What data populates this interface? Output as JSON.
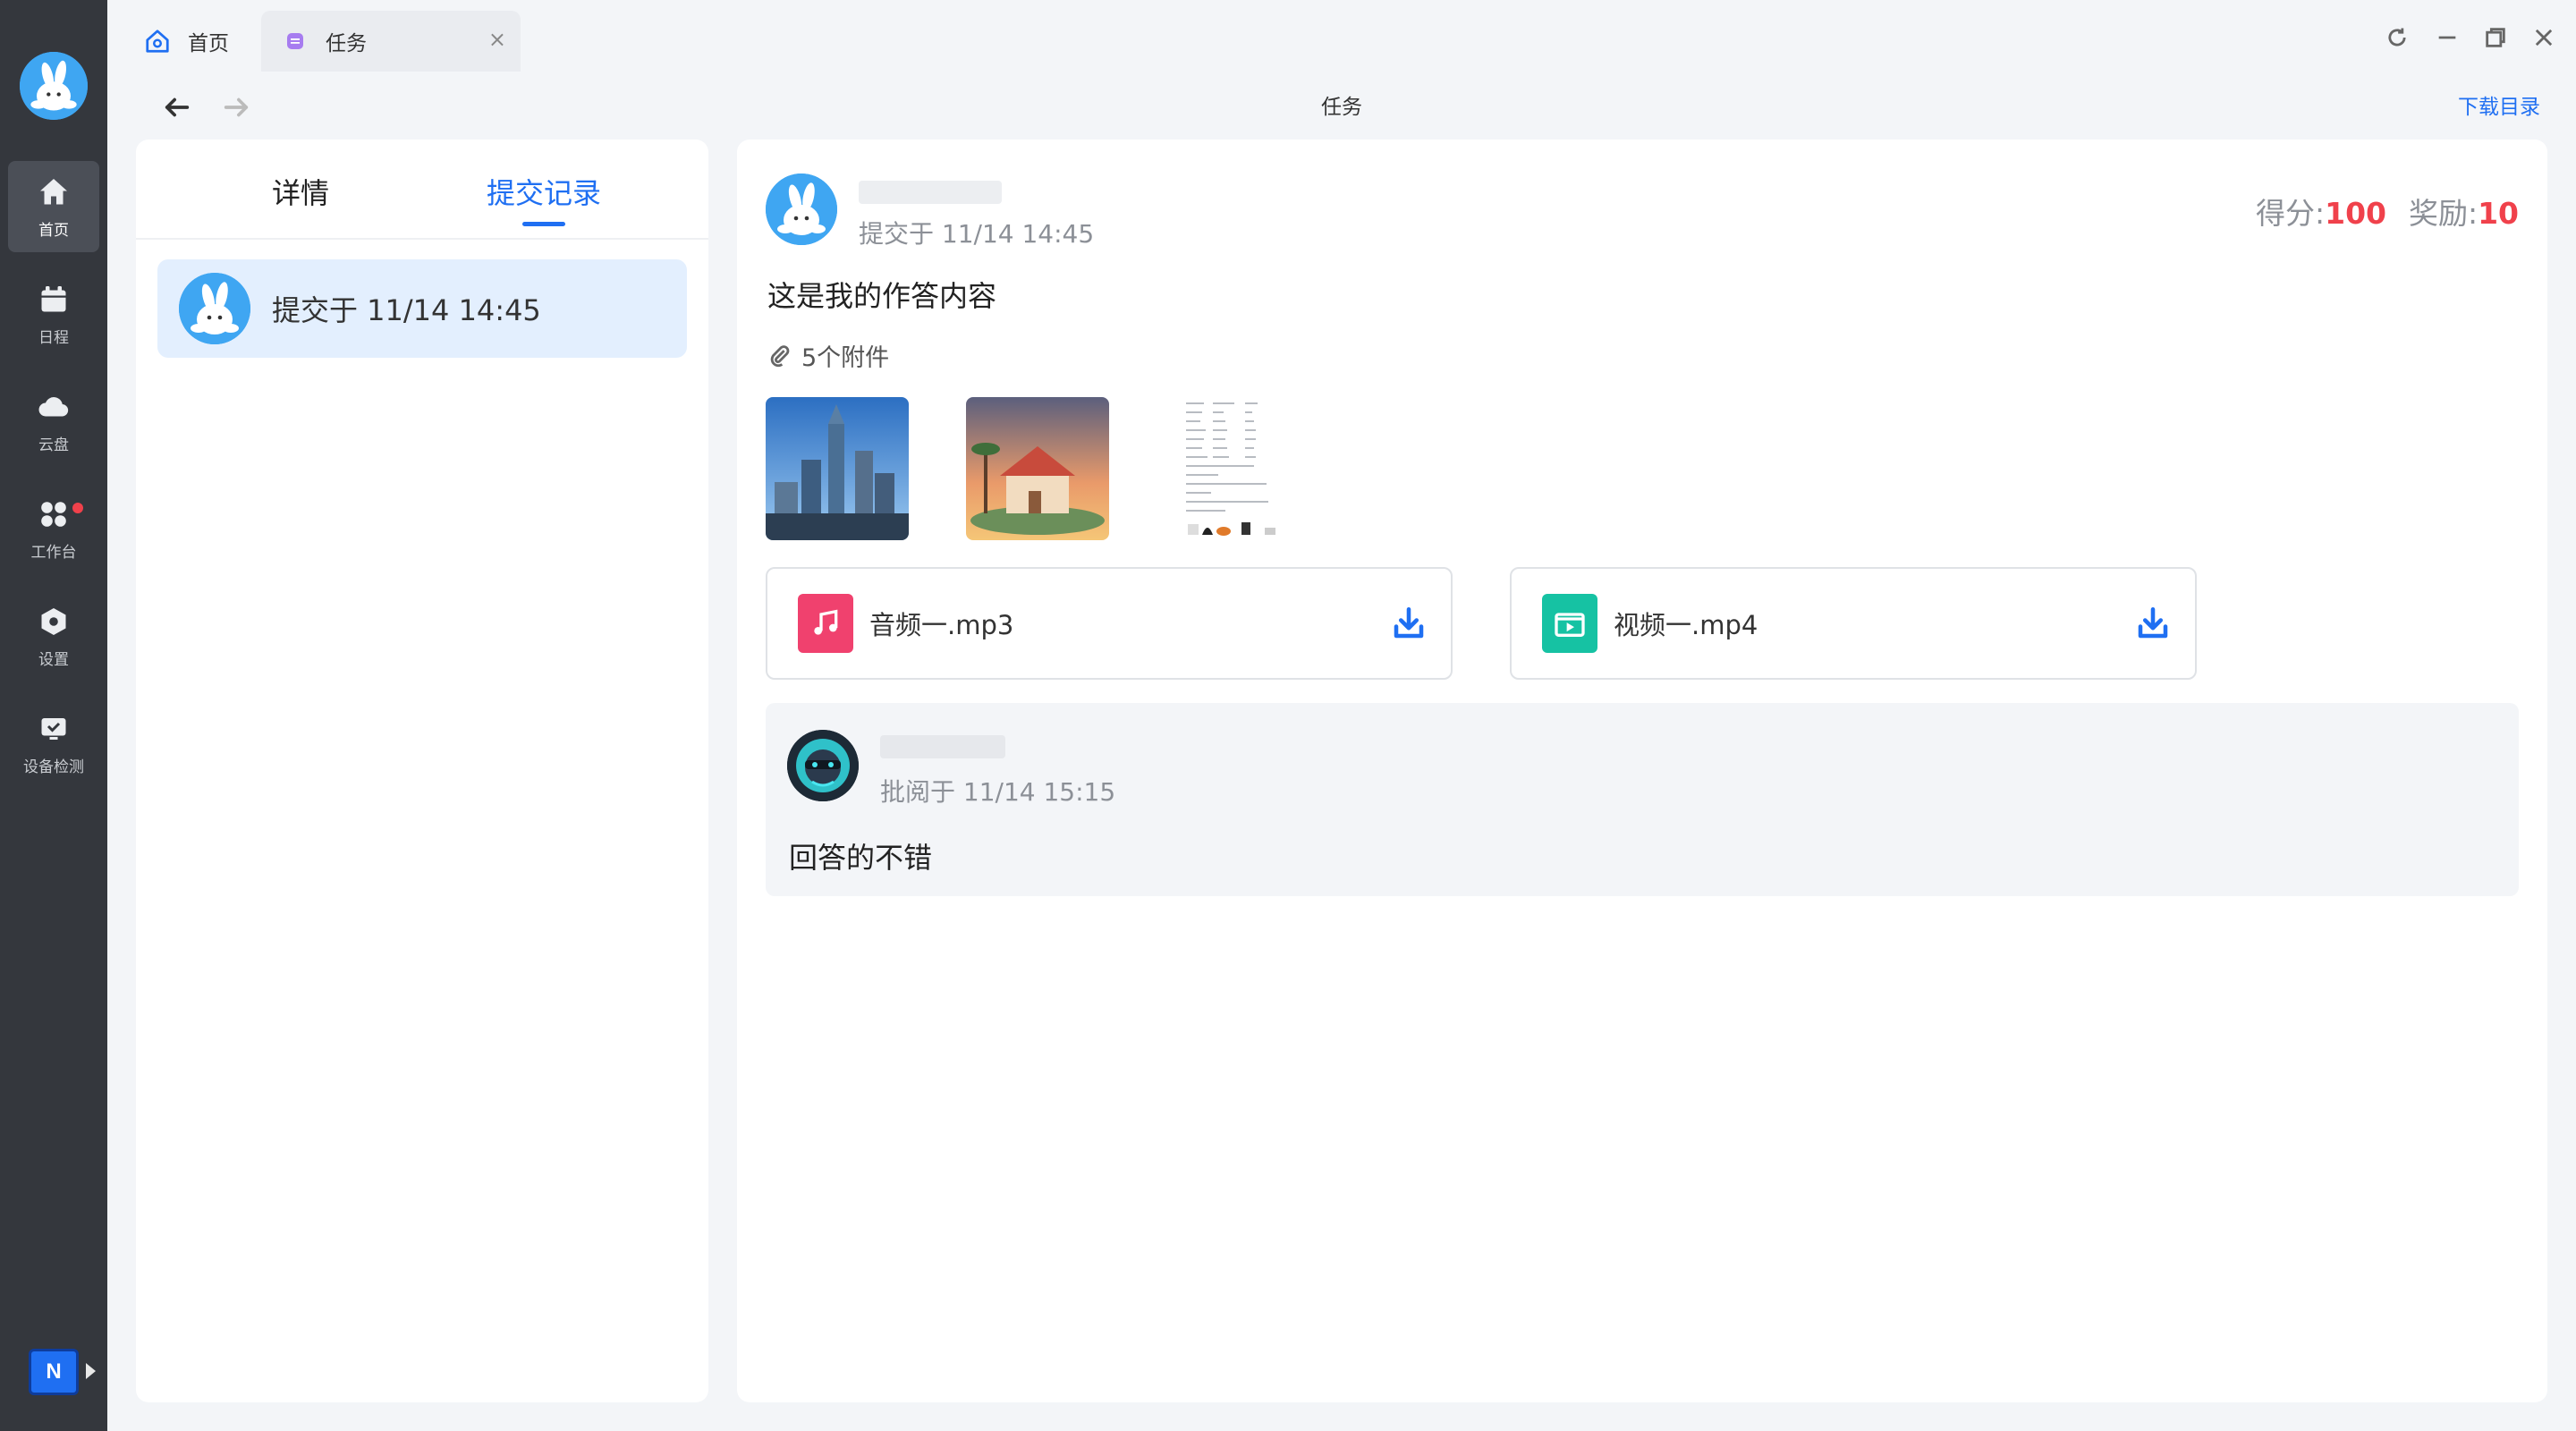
{
  "sidebar": {
    "items": [
      {
        "label": "首页",
        "icon": "home-icon",
        "active": true
      },
      {
        "label": "日程",
        "icon": "calendar-icon"
      },
      {
        "label": "云盘",
        "icon": "cloud-icon"
      },
      {
        "label": "工作台",
        "icon": "apps-icon",
        "badge_dot": true
      },
      {
        "label": "设置",
        "icon": "settings-hexagon-icon"
      },
      {
        "label": "设备检测",
        "icon": "device-check-icon"
      }
    ],
    "bottom_badge": "N"
  },
  "tabs": [
    {
      "label": "首页",
      "icon": "home-tab-icon"
    },
    {
      "label": "任务",
      "icon": "task-tab-icon",
      "close": "×",
      "active": true
    }
  ],
  "header": {
    "title": "任务",
    "download_dir": "下载目录"
  },
  "left_panel": {
    "tabs": [
      "详情",
      "提交记录"
    ],
    "active_tab": "提交记录",
    "records": [
      {
        "text": "提交于 11/14 14:45"
      }
    ]
  },
  "submission": {
    "time": "提交于 11/14 14:45",
    "score_label": "得分:",
    "score_value": "100",
    "reward_label": "奖励:",
    "reward_value": "10",
    "answer": "这是我的作答内容",
    "attachments_label": "5个附件",
    "files": [
      {
        "name": "音频一.mp3",
        "icon": "audio-file-icon"
      },
      {
        "name": "视频一.mp4",
        "icon": "video-file-icon"
      }
    ]
  },
  "review": {
    "time": "批阅于 11/14 15:15",
    "comment": "回答的不错"
  },
  "colors": {
    "accent": "#1f6ff2",
    "score_red": "#f0414b",
    "sidebar_bg": "#34373d",
    "audio_icon": "#f0416e",
    "video_icon": "#16c2a3"
  }
}
